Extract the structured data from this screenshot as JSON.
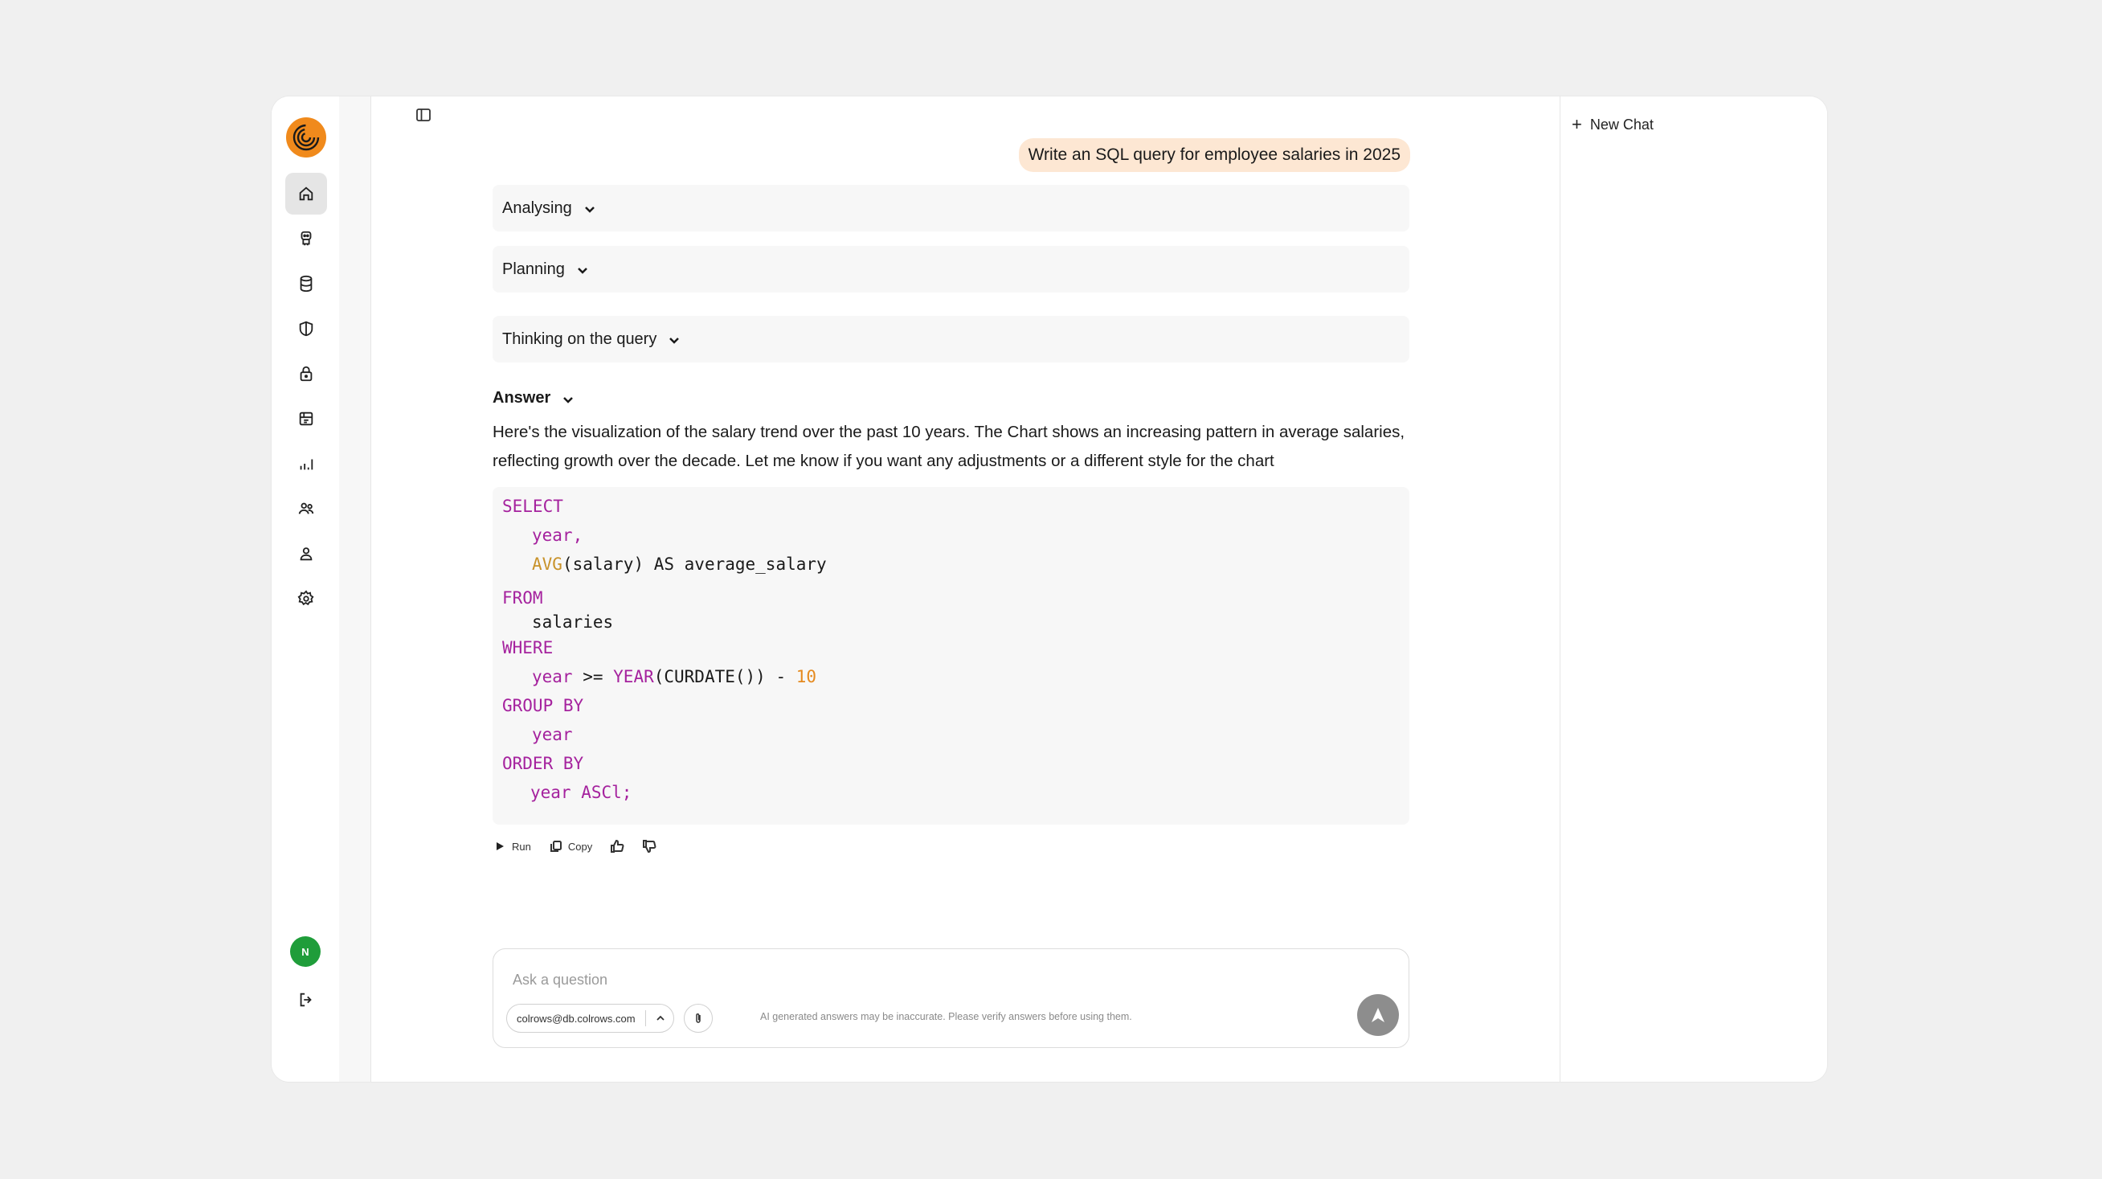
{
  "sidebar": {
    "items": [
      {
        "name": "home-icon",
        "active": true
      },
      {
        "name": "agent-icon",
        "active": false
      },
      {
        "name": "database-icon",
        "active": false
      },
      {
        "name": "shield-icon",
        "active": false
      },
      {
        "name": "lock-icon",
        "active": false
      },
      {
        "name": "catalog-icon",
        "active": false
      },
      {
        "name": "analytics-icon",
        "active": false
      },
      {
        "name": "users-icon",
        "active": false
      },
      {
        "name": "user-icon",
        "active": false
      },
      {
        "name": "settings-icon",
        "active": false
      }
    ],
    "avatar_initial": "N"
  },
  "right_panel": {
    "new_chat_label": "New Chat"
  },
  "conversation": {
    "user_message": "Write an SQL query for employee salaries in 2025",
    "steps": [
      {
        "label": "Analysing"
      },
      {
        "label": "Planning"
      },
      {
        "label": "Thinking on the query"
      }
    ],
    "answer_label": "Answer",
    "answer_text_line1": "Here's the visualization of the salary trend over the past 10 years. The Chart shows an increasing pattern in average salaries,",
    "answer_text_line2": "reflecting growth over the decade. Let me know if you want any adjustments or a different style for the chart",
    "code": {
      "select": "SELECT",
      "year_comma": "year,",
      "avg_fn": "AVG",
      "avg_rest": "(salary) AS average_salary",
      "from": "FROM",
      "salaries": "salaries",
      "where": "WHERE",
      "where_year": "year",
      "where_op": " >= ",
      "year_fn": "YEAR",
      "curdate": "(CURDATE()) - ",
      "ten": "10",
      "group_by": "GROUP BY",
      "group_year": "year",
      "order_by": "ORDER BY",
      "order_year": "year ASCl;"
    },
    "actions": {
      "run_label": "Run",
      "copy_label": "Copy"
    }
  },
  "composer": {
    "placeholder": "Ask a question",
    "connection": "colrows@db.colrows.com",
    "disclaimer": "AI generated answers may be inaccurate. Please verify answers before using them."
  },
  "colors": {
    "accent": "#f08a1c",
    "keyword": "#a5229e",
    "function": "#c8922a",
    "number": "#e58a1f",
    "user_bubble": "#fde7d3",
    "avatar": "#1f9d3a"
  }
}
